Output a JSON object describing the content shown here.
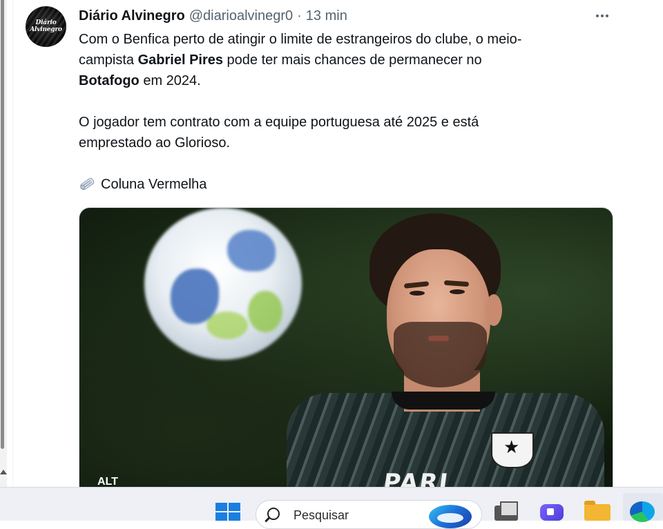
{
  "tweet": {
    "author_name": "Diário Alvinegro",
    "handle": "@diarioalvinegr0",
    "separator": "·",
    "time": "13 min",
    "avatar_text_1": "Diário",
    "avatar_text_2": "Alvinegro",
    "lines": {
      "l1": "Com o Benfica perto de atingir o limite de estrangeiros do clube, o meio-",
      "l2_pre": "campista ",
      "l2_bold": "Gabriel Pires",
      "l2_post": " pode ter mais chances de permanecer no",
      "l3_bold": "Botafogo",
      "l3_post": " em 2024.",
      "l4": "O jogador tem contrato com a equipe portuguesa até 2025 e está",
      "l5": "emprestado ao Glorioso.",
      "l6": "Coluna Vermelha"
    },
    "media": {
      "alt_badge": "ALT",
      "sponsor_text": "PARI"
    }
  },
  "taskbar": {
    "search_placeholder": "Pesquisar"
  },
  "icons": {
    "more": "more-icon",
    "news": "newspaper-icon",
    "windows": "windows-start-icon",
    "search": "search-icon",
    "edge": "edge-browser-icon"
  },
  "colors": {
    "text_primary": "#0f1419",
    "text_secondary": "#536471",
    "windows_blue": "#1a7fe0"
  }
}
